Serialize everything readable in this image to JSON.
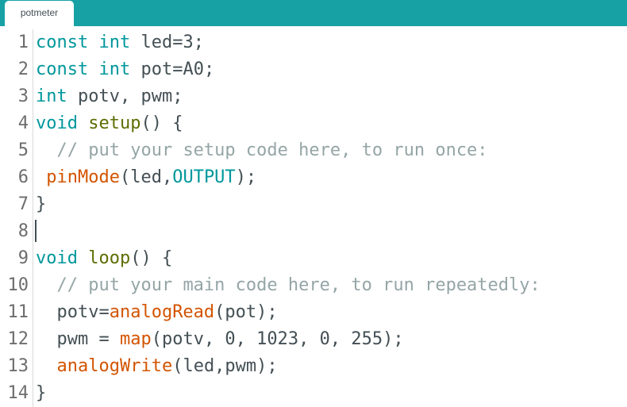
{
  "tab": {
    "label": "potmeter"
  },
  "lines": [
    {
      "n": "1",
      "parts": [
        [
          "kw",
          "const"
        ],
        [
          "t",
          " "
        ],
        [
          "kw",
          "int"
        ],
        [
          "t",
          " led=3;"
        ]
      ]
    },
    {
      "n": "2",
      "parts": [
        [
          "kw",
          "const"
        ],
        [
          "t",
          " "
        ],
        [
          "kw",
          "int"
        ],
        [
          "t",
          " pot=A0;"
        ]
      ]
    },
    {
      "n": "3",
      "parts": [
        [
          "kw",
          "int"
        ],
        [
          "t",
          " potv, pwm;"
        ]
      ]
    },
    {
      "n": "4",
      "parts": [
        [
          "kw",
          "void"
        ],
        [
          "t",
          " "
        ],
        [
          "ty",
          "setup"
        ],
        [
          "t",
          "() {"
        ]
      ]
    },
    {
      "n": "5",
      "parts": [
        [
          "t",
          "  "
        ],
        [
          "cm",
          "// put your setup code here, to run once:"
        ]
      ]
    },
    {
      "n": "6",
      "parts": [
        [
          "t",
          " "
        ],
        [
          "fn",
          "pinMode"
        ],
        [
          "t",
          "(led,"
        ],
        [
          "kw",
          "OUTPUT"
        ],
        [
          "t",
          ");"
        ]
      ]
    },
    {
      "n": "7",
      "parts": [
        [
          "t",
          "}"
        ]
      ]
    },
    {
      "n": "8",
      "parts": []
    },
    {
      "n": "9",
      "parts": [
        [
          "kw",
          "void"
        ],
        [
          "t",
          " "
        ],
        [
          "ty",
          "loop"
        ],
        [
          "t",
          "() {"
        ]
      ]
    },
    {
      "n": "10",
      "parts": [
        [
          "t",
          "  "
        ],
        [
          "cm",
          "// put your main code here, to run repeatedly:"
        ]
      ]
    },
    {
      "n": "11",
      "parts": [
        [
          "t",
          "  potv="
        ],
        [
          "fn",
          "analogRead"
        ],
        [
          "t",
          "(pot);"
        ]
      ]
    },
    {
      "n": "12",
      "parts": [
        [
          "t",
          "  pwm = "
        ],
        [
          "fn",
          "map"
        ],
        [
          "t",
          "(potv, 0, 1023, 0, 255);"
        ]
      ]
    },
    {
      "n": "13",
      "parts": [
        [
          "t",
          "  "
        ],
        [
          "fn",
          "analogWrite"
        ],
        [
          "t",
          "(led,pwm);"
        ]
      ]
    },
    {
      "n": "14",
      "parts": [
        [
          "t",
          "}"
        ]
      ]
    }
  ]
}
